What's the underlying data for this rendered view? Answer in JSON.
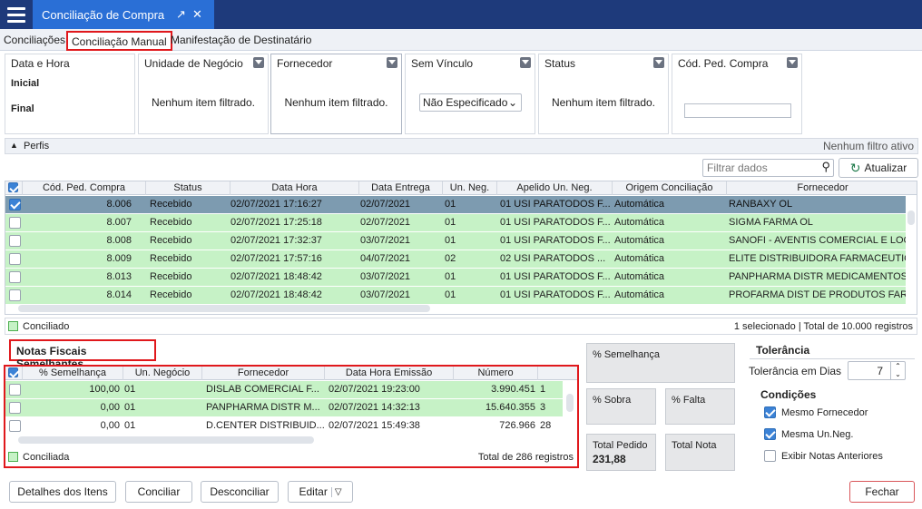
{
  "window": {
    "title": "Conciliação de Compra"
  },
  "tabs": [
    "Conciliações",
    "Conciliação Manual",
    "Manifestação de Destinatário"
  ],
  "filters": {
    "data_hora": {
      "label": "Data e Hora",
      "inicial": "Inicial",
      "final": "Final"
    },
    "unidade": {
      "label": "Unidade de Negócio",
      "empty": "Nenhum item filtrado."
    },
    "fornecedor": {
      "label": "Fornecedor",
      "empty": "Nenhum item filtrado."
    },
    "sem_vinculo": {
      "label": "Sem Vínculo",
      "value": "Não Especificado"
    },
    "status": {
      "label": "Status",
      "empty": "Nenhum item filtrado."
    },
    "cod_ped": {
      "label": "Cód. Ped. Compra",
      "value": ""
    }
  },
  "perfis": {
    "label": "Perfis",
    "status": "Nenhum filtro ativo"
  },
  "toolbar": {
    "search_placeholder": "Filtrar dados",
    "refresh_label": "Atualizar"
  },
  "orders_grid": {
    "columns": [
      "Cód. Ped. Compra",
      "Status",
      "Data Hora",
      "Data Entrega",
      "Un. Neg.",
      "Apelido Un. Neg.",
      "Origem Conciliação",
      "Fornecedor"
    ],
    "rows": [
      {
        "checked": true,
        "cod": "8.006",
        "status": "Recebido",
        "datahora": "02/07/2021 17:16:27",
        "entrega": "02/07/2021",
        "un": "01",
        "apelido": "01 USI PARATODOS F...",
        "origem": "Automática",
        "fornecedor": "RANBAXY OL"
      },
      {
        "checked": false,
        "cod": "8.007",
        "status": "Recebido",
        "datahora": "02/07/2021 17:25:18",
        "entrega": "02/07/2021",
        "un": "01",
        "apelido": "01 USI PARATODOS F...",
        "origem": "Automática",
        "fornecedor": "SIGMA FARMA OL"
      },
      {
        "checked": false,
        "cod": "8.008",
        "status": "Recebido",
        "datahora": "02/07/2021 17:32:37",
        "entrega": "03/07/2021",
        "un": "01",
        "apelido": "01 USI PARATODOS F...",
        "origem": "Automática",
        "fornecedor": "SANOFI - AVENTIS COMERCIAL E LOG"
      },
      {
        "checked": false,
        "cod": "8.009",
        "status": "Recebido",
        "datahora": "02/07/2021 17:57:16",
        "entrega": "04/07/2021",
        "un": "02",
        "apelido": "02 USI PARATODOS ...",
        "origem": "Automática",
        "fornecedor": "ELITE DISTRIBUIDORA FARMACEUTIC"
      },
      {
        "checked": false,
        "cod": "8.013",
        "status": "Recebido",
        "datahora": "02/07/2021 18:48:42",
        "entrega": "03/07/2021",
        "un": "01",
        "apelido": "01 USI PARATODOS F...",
        "origem": "Automática",
        "fornecedor": "PANPHARMA DISTR MEDICAMENTOS"
      },
      {
        "checked": false,
        "cod": "8.014",
        "status": "Recebido",
        "datahora": "02/07/2021 18:48:42",
        "entrega": "03/07/2021",
        "un": "01",
        "apelido": "01 USI PARATODOS F...",
        "origem": "Automática",
        "fornecedor": "PROFARMA DIST DE PRODUTOS FARM"
      }
    ],
    "legend": "Conciliado",
    "status": "1 selecionado | Total de 10.000 registros"
  },
  "notas": {
    "title": "Notas Fiscais Semelhantes",
    "columns": [
      "% Semelhança",
      "Un. Negócio",
      "Fornecedor",
      "Data Hora Emissão",
      "Número"
    ],
    "rows": [
      {
        "sem": "100,00",
        "un": "01",
        "forn": "DISLAB COMERCIAL F...",
        "data": "02/07/2021 19:23:00",
        "num": "3.990.451",
        "extra": "1"
      },
      {
        "sem": "0,00",
        "un": "01",
        "forn": "PANPHARMA DISTR M...",
        "data": "02/07/2021 14:32:13",
        "num": "15.640.355",
        "extra": "3"
      },
      {
        "sem": "0,00",
        "un": "01",
        "forn": "D.CENTER DISTRIBUID...",
        "data": "02/07/2021 15:49:38",
        "num": "726.966",
        "extra": "28"
      }
    ],
    "legend": "Conciliada",
    "status": "Total de 286 registros"
  },
  "cards": {
    "semelhanca": "% Semelhança",
    "sobra": "% Sobra",
    "falta": "% Falta",
    "total_pedido": "Total Pedido",
    "total_pedido_value": "231,88",
    "total_nota": "Total Nota"
  },
  "tolerancia": {
    "title": "Tolerância",
    "dias_label": "Tolerância em Dias",
    "dias_value": "7"
  },
  "condicoes": {
    "title": "Condições",
    "items": [
      {
        "label": "Mesmo Fornecedor",
        "checked": true
      },
      {
        "label": "Mesma Un.Neg.",
        "checked": true
      },
      {
        "label": "Exibir Notas Anteriores",
        "checked": false
      }
    ]
  },
  "buttons": {
    "detalhes": "Detalhes dos Itens",
    "conciliar": "Conciliar",
    "desconciliar": "Desconciliar",
    "editar": "Editar",
    "fechar": "Fechar"
  },
  "colors": {
    "titlebar": "#1e3a7b",
    "tab_active": "#2a6fd6",
    "row_green": "#c6f2c6",
    "row_selected": "#7d9bb0",
    "highlight_red": "#e0181c"
  }
}
